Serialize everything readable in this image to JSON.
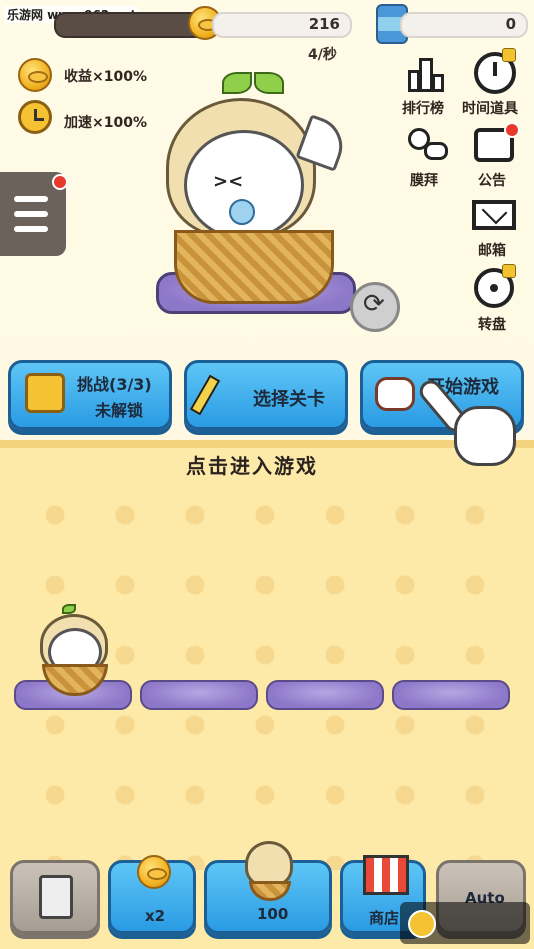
{
  "watermark": "乐游网 www.962.net",
  "currency": {
    "coins": "216",
    "rate": "4/秒",
    "cans": "0"
  },
  "buffs": [
    {
      "label": "收益×100%",
      "icon": "coin-up-icon"
    },
    {
      "label": "加速×100%",
      "icon": "alarm-clock-icon"
    }
  ],
  "right_menu": [
    {
      "label": "排行榜",
      "icon": "leaderboard-icon"
    },
    {
      "label": "时间道具",
      "icon": "stopwatch-icon"
    },
    {
      "label": "膜拜",
      "icon": "worship-icon"
    },
    {
      "label": "公告",
      "icon": "notice-icon"
    },
    {
      "label": "邮箱",
      "icon": "mail-icon"
    },
    {
      "label": "转盘",
      "icon": "wheel-icon"
    }
  ],
  "actions": {
    "challenge_label": "挑战(3/3)",
    "challenge_sub": "未解锁",
    "select_label": "选择关卡",
    "start_label": "开始游戏"
  },
  "hint": "点击进入游戏",
  "bottom": {
    "coin_mult": "x2",
    "buy_price": "100",
    "shop_label": "商店",
    "auto_label": "Auto"
  },
  "logo": "962.NET 乐游网",
  "colors": {
    "accent": "#2a9be3",
    "floor": "#fde9a8",
    "alert": "#e83a2c"
  }
}
